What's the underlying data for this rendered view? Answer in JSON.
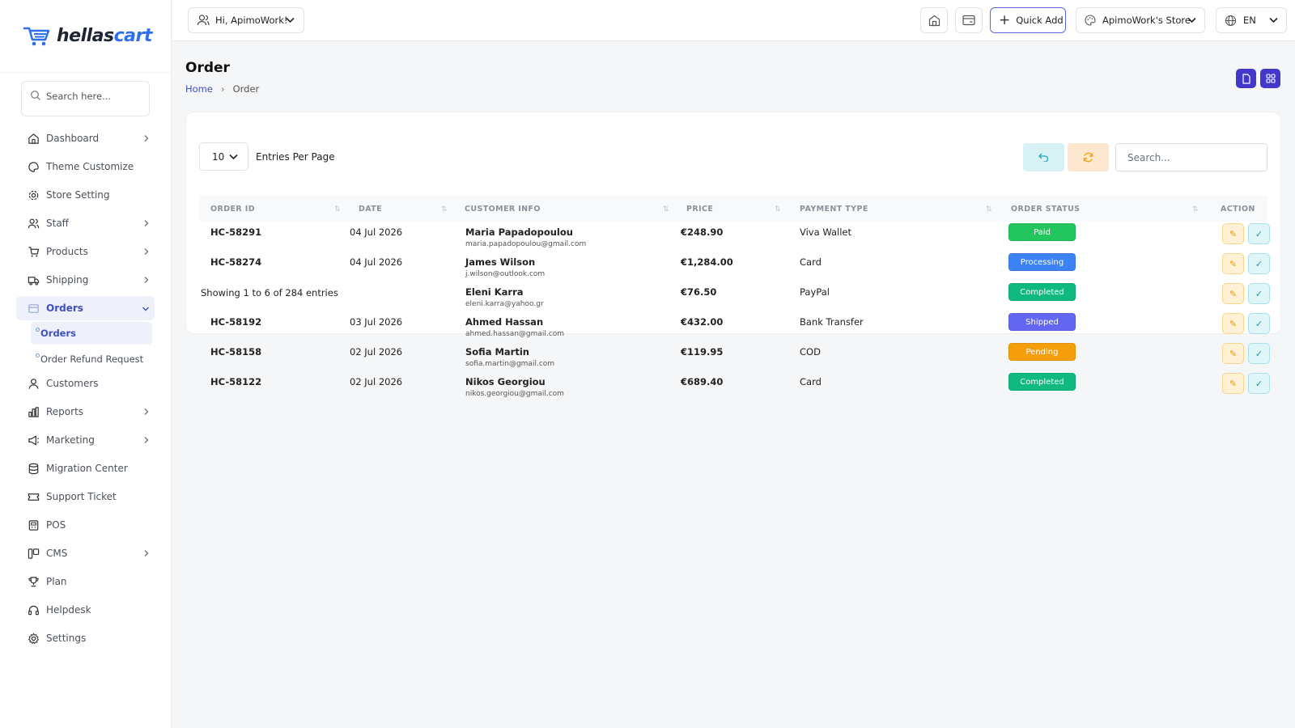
{
  "sidebar": {
    "logo": {
      "part1": "hellas",
      "part2": "cart"
    },
    "search_placeholder": "Search here...",
    "items": [
      {
        "label": "Dashboard",
        "icon": "home-icon",
        "chevron": true
      },
      {
        "label": "Theme Customize",
        "icon": "palette-icon",
        "chevron": false
      },
      {
        "label": "Store Setting",
        "icon": "gear-icon",
        "chevron": false
      },
      {
        "label": "Staff",
        "icon": "users-icon",
        "chevron": true
      },
      {
        "label": "Products",
        "icon": "cart-icon",
        "chevron": true
      },
      {
        "label": "Shipping",
        "icon": "truck-icon",
        "chevron": true
      },
      {
        "label": "Orders",
        "icon": "box-icon",
        "chevron": true
      },
      {
        "label": "Customers",
        "icon": "user-icon",
        "chevron": false
      },
      {
        "label": "Reports",
        "icon": "chart-icon",
        "chevron": true
      },
      {
        "label": "Marketing",
        "icon": "megaphone-icon",
        "chevron": true
      },
      {
        "label": "Migration Center",
        "icon": "database-icon",
        "chevron": false
      },
      {
        "label": "Support Ticket",
        "icon": "ticket-icon",
        "chevron": false
      },
      {
        "label": "POS",
        "icon": "register-icon",
        "chevron": false
      },
      {
        "label": "CMS",
        "icon": "layout-icon",
        "chevron": true
      },
      {
        "label": "Plan",
        "icon": "trophy-icon",
        "chevron": false
      },
      {
        "label": "Helpdesk",
        "icon": "headset-icon",
        "chevron": false
      },
      {
        "label": "Settings",
        "icon": "settings-icon",
        "chevron": false
      }
    ],
    "sub_items": [
      {
        "label": "Orders"
      },
      {
        "label": "Order Refund Request"
      }
    ]
  },
  "header": {
    "greeting": "Hi, ApimoWork!",
    "quick_add": "Quick Add",
    "store": "ApimoWork's Store",
    "language": "EN"
  },
  "page": {
    "title": "Order",
    "breadcrumb": {
      "home": "Home",
      "current": "Order"
    }
  },
  "table": {
    "entries_value": "10",
    "entries_label": "Entries Per Page",
    "search_placeholder": "Search...",
    "columns": [
      "ORDER ID",
      "DATE",
      "CUSTOMER INFO",
      "PRICE",
      "PAYMENT TYPE",
      "ORDER STATUS",
      "ACTION"
    ],
    "rows": [
      {
        "id": "HC-58291",
        "date": "04 Jul 2026",
        "name": "Maria Papadopoulou",
        "email": "maria.papadopoulou@gmail.com",
        "price": "€248.90",
        "payment": "Viva Wallet",
        "status": "Paid",
        "status_color": "#22c55e"
      },
      {
        "id": "HC-58274",
        "date": "04 Jul 2026",
        "name": "James Wilson",
        "email": "j.wilson@outlook.com",
        "price": "€1,284.00",
        "payment": "Card",
        "status": "Processing",
        "status_color": "#3b82f6"
      },
      {
        "id": "",
        "date": "",
        "name": "Eleni Karra",
        "email": "eleni.karra@yahoo.gr",
        "price": "€76.50",
        "payment": "PayPal",
        "status": "Completed",
        "status_color": "#10b981"
      },
      {
        "id": "HC-58192",
        "date": "03 Jul 2026",
        "name": "Ahmed Hassan",
        "email": "ahmed.hassan@gmail.com",
        "price": "€432.00",
        "payment": "Bank Transfer",
        "status": "Shipped",
        "status_color": "#6366f1"
      },
      {
        "id": "HC-58158",
        "date": "02 Jul 2026",
        "name": "Sofia Martin",
        "email": "sofia.martin@gmail.com",
        "price": "€119.95",
        "payment": "COD",
        "status": "Pending",
        "status_color": "#f59e0b"
      },
      {
        "id": "HC-58122",
        "date": "02 Jul 2026",
        "name": "Nikos Georgiou",
        "email": "nikos.georgiou@gmail.com",
        "price": "€689.40",
        "payment": "Card",
        "status": "Completed",
        "status_color": "#10b981"
      }
    ],
    "showing": "Showing 1 to 6 of 284 entries"
  },
  "colors": {
    "accent": "#4338ca",
    "link": "#3f4fbf"
  }
}
